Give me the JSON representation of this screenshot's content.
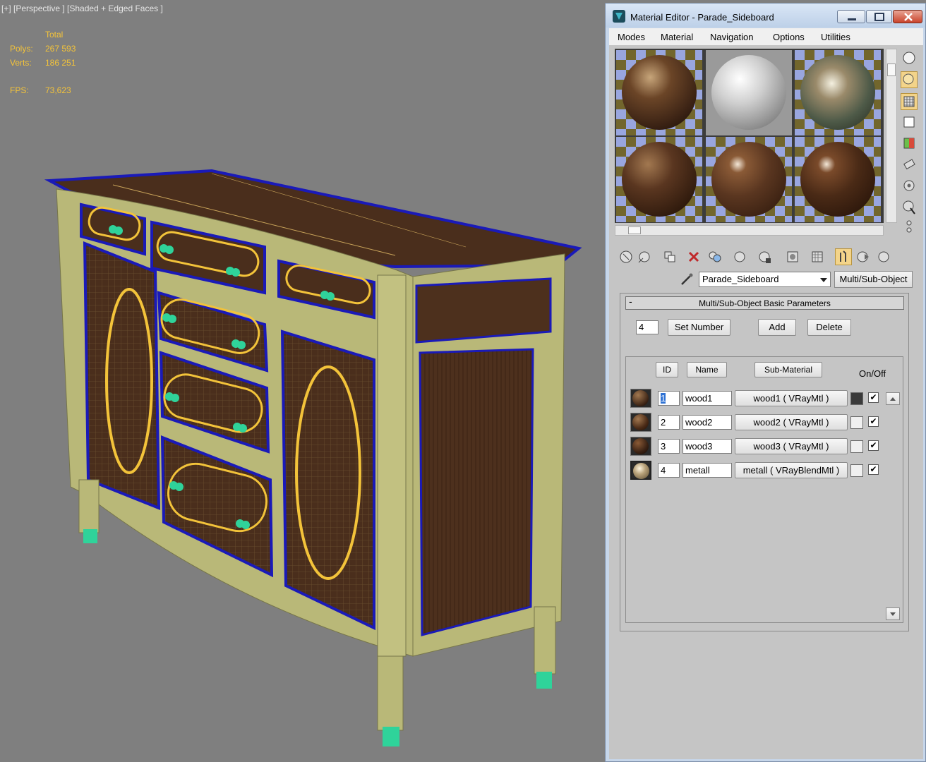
{
  "viewport": {
    "label": "[+] [Perspective ] [Shaded + Edged Faces ]",
    "stats": {
      "total_header": "Total",
      "polys_label": "Polys:",
      "polys_value": "267 593",
      "verts_label": "Verts:",
      "verts_value": "186 251",
      "fps_label": "FPS:",
      "fps_value": "73,623"
    }
  },
  "window": {
    "title": "Material Editor - Parade_Sideboard"
  },
  "menu": [
    "Modes",
    "Material",
    "Navigation",
    "Options",
    "Utilities"
  ],
  "icons": {
    "app": "3dsmax-icon",
    "minimize": "minimize-icon",
    "maximize": "maximize-icon",
    "close": "close-icon"
  },
  "material": {
    "name": "Parade_Sideboard",
    "type": "Multi/Sub-Object"
  },
  "rollout": {
    "toggle": "-",
    "title": "Multi/Sub-Object Basic Parameters",
    "count": "4",
    "set_number": "Set Number",
    "add": "Add",
    "delete": "Delete",
    "col_id": "ID",
    "col_name": "Name",
    "col_submaterial": "Sub-Material",
    "col_onoff": "On/Off",
    "rows": [
      {
        "id": "1",
        "name": "wood1",
        "sub": "wood1  ( VRayMtl )",
        "on": "✔"
      },
      {
        "id": "2",
        "name": "wood2",
        "sub": "wood2  ( VRayMtl )",
        "on": "✔"
      },
      {
        "id": "3",
        "name": "wood3",
        "sub": "wood3  ( VRayMtl )",
        "on": "✔"
      },
      {
        "id": "4",
        "name": "metall",
        "sub": "metall  ( VRayBlendMtl )",
        "on": "✔"
      }
    ]
  },
  "colors": {
    "wood": "#4a2e1c",
    "yellow_wire": "#f3c33a",
    "blue_wire": "#1a1ab8",
    "frame": "#b9b878",
    "selection_green": "#2fd39a"
  }
}
